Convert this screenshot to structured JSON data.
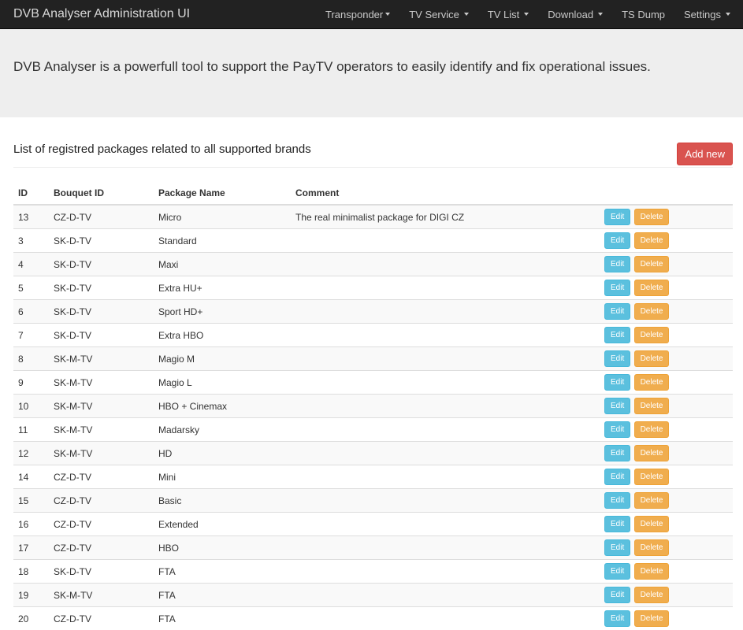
{
  "navbar": {
    "brand": "DVB Analyser Administration UI",
    "items": [
      {
        "label": "Transponder",
        "dropdown": true
      },
      {
        "label": "TV Service",
        "dropdown": true
      },
      {
        "label": "TV List",
        "dropdown": true
      },
      {
        "label": "Download",
        "dropdown": true
      },
      {
        "label": "TS Dump",
        "dropdown": false
      },
      {
        "label": "Settings",
        "dropdown": true
      }
    ]
  },
  "jumbotron": {
    "lead": "DVB Analyser is a powerfull tool to support the PayTV operators to easily identify and fix operational issues."
  },
  "main": {
    "title": "List of registred packages related to all supported brands",
    "add_button": "Add new",
    "table": {
      "headers": [
        "ID",
        "Bouquet ID",
        "Package Name",
        "Comment",
        ""
      ],
      "edit_label": "Edit",
      "delete_label": "Delete",
      "rows": [
        {
          "id": "13",
          "bouquet": "CZ-D-TV",
          "package": "Micro",
          "comment": "The real minimalist package for DIGI CZ"
        },
        {
          "id": "3",
          "bouquet": "SK-D-TV",
          "package": "Standard",
          "comment": ""
        },
        {
          "id": "4",
          "bouquet": "SK-D-TV",
          "package": "Maxi",
          "comment": ""
        },
        {
          "id": "5",
          "bouquet": "SK-D-TV",
          "package": "Extra HU+",
          "comment": ""
        },
        {
          "id": "6",
          "bouquet": "SK-D-TV",
          "package": "Sport HD+",
          "comment": ""
        },
        {
          "id": "7",
          "bouquet": "SK-D-TV",
          "package": "Extra HBO",
          "comment": ""
        },
        {
          "id": "8",
          "bouquet": "SK-M-TV",
          "package": "Magio M",
          "comment": ""
        },
        {
          "id": "9",
          "bouquet": "SK-M-TV",
          "package": "Magio L",
          "comment": ""
        },
        {
          "id": "10",
          "bouquet": "SK-M-TV",
          "package": "HBO + Cinemax",
          "comment": ""
        },
        {
          "id": "11",
          "bouquet": "SK-M-TV",
          "package": "Madarsky",
          "comment": ""
        },
        {
          "id": "12",
          "bouquet": "SK-M-TV",
          "package": "HD",
          "comment": ""
        },
        {
          "id": "14",
          "bouquet": "CZ-D-TV",
          "package": "Mini",
          "comment": ""
        },
        {
          "id": "15",
          "bouquet": "CZ-D-TV",
          "package": "Basic",
          "comment": ""
        },
        {
          "id": "16",
          "bouquet": "CZ-D-TV",
          "package": "Extended",
          "comment": ""
        },
        {
          "id": "17",
          "bouquet": "CZ-D-TV",
          "package": "HBO",
          "comment": ""
        },
        {
          "id": "18",
          "bouquet": "SK-D-TV",
          "package": "FTA",
          "comment": ""
        },
        {
          "id": "19",
          "bouquet": "SK-M-TV",
          "package": "FTA",
          "comment": ""
        },
        {
          "id": "20",
          "bouquet": "CZ-D-TV",
          "package": "FTA",
          "comment": ""
        }
      ]
    }
  },
  "colors": {
    "navbar_bg": "#222222",
    "jumbotron_bg": "#eeeeee",
    "add_button": "#d9534f",
    "edit_button": "#5bc0de",
    "delete_button": "#f0ad4e"
  }
}
